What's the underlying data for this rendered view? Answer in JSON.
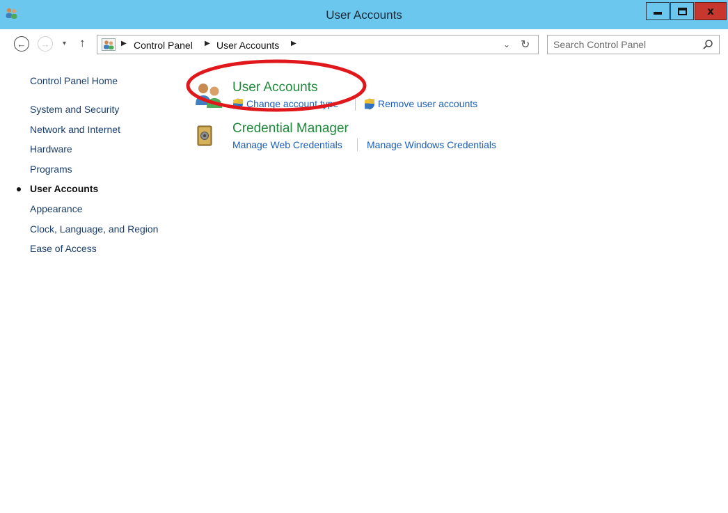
{
  "window": {
    "title": "User Accounts",
    "controls": {
      "minimize": "minimize",
      "maximize": "maximize",
      "close": "x"
    }
  },
  "nav": {
    "back_glyph": "←",
    "forward_glyph": "→",
    "recent_glyph": "▾",
    "up_glyph": "↑",
    "breadcrumb": [
      "Control Panel",
      "User Accounts"
    ],
    "dropdown_glyph": "⌄",
    "refresh_glyph": "↻",
    "search_placeholder": "Search Control Panel"
  },
  "sidebar": {
    "items": [
      {
        "label": "Control Panel Home",
        "active": false
      },
      {
        "label": "System and Security",
        "active": false
      },
      {
        "label": "Network and Internet",
        "active": false
      },
      {
        "label": "Hardware",
        "active": false
      },
      {
        "label": "Programs",
        "active": false
      },
      {
        "label": "User Accounts",
        "active": true
      },
      {
        "label": "Appearance",
        "active": false
      },
      {
        "label": "Clock, Language, and Region",
        "active": false
      },
      {
        "label": "Ease of Access",
        "active": false
      }
    ]
  },
  "main": {
    "categories": [
      {
        "title": "User Accounts",
        "icon": "users-icon",
        "links": [
          "Change account type",
          "Remove user accounts"
        ]
      },
      {
        "title": "Credential Manager",
        "icon": "credential-vault-icon",
        "links": [
          "Manage Web Credentials",
          "Manage Windows Credentials"
        ]
      }
    ]
  },
  "colors": {
    "titlebar": "#6cc7ee",
    "close_button": "#c7372d",
    "category_title": "#1e8a3a",
    "link": "#1a5db8",
    "highlight": "#e0181c"
  }
}
